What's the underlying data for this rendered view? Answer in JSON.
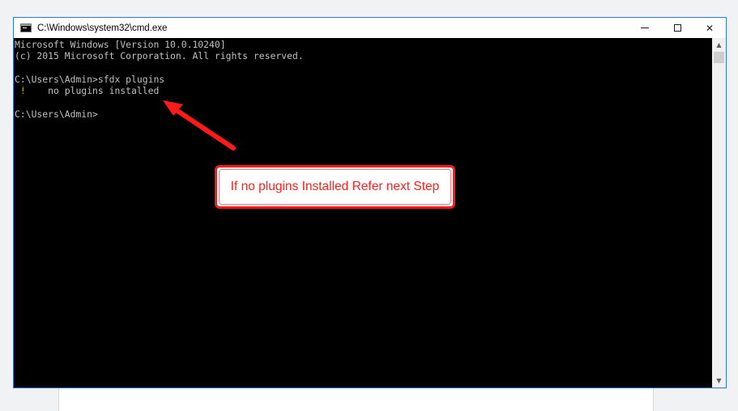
{
  "window": {
    "title": "C:\\Windows\\system32\\cmd.exe",
    "minimize_label": "—",
    "close_label": "✕"
  },
  "console": {
    "lines": [
      "Microsoft Windows [Version 10.0.10240]",
      "(c) 2015 Microsoft Corporation. All rights reserved.",
      "",
      "C:\\Users\\Admin>sfdx plugins",
      "",
      "",
      "C:\\Users\\Admin>"
    ],
    "warning": {
      "mark": " !",
      "text": "    no plugins installed"
    }
  },
  "annotation": {
    "text": "If no plugins Installed Refer next Step",
    "color": "#ff2020"
  },
  "colors": {
    "console_bg": "#000000",
    "console_text": "#c0c0c0",
    "warning": "#c8b400",
    "window_border": "#2b78d6"
  },
  "icons": {
    "app": "cmd-icon",
    "minimize": "minimize-icon",
    "maximize": "maximize-icon",
    "close": "close-icon",
    "scroll_up": "chevron-up-icon",
    "scroll_down": "chevron-down-icon"
  }
}
